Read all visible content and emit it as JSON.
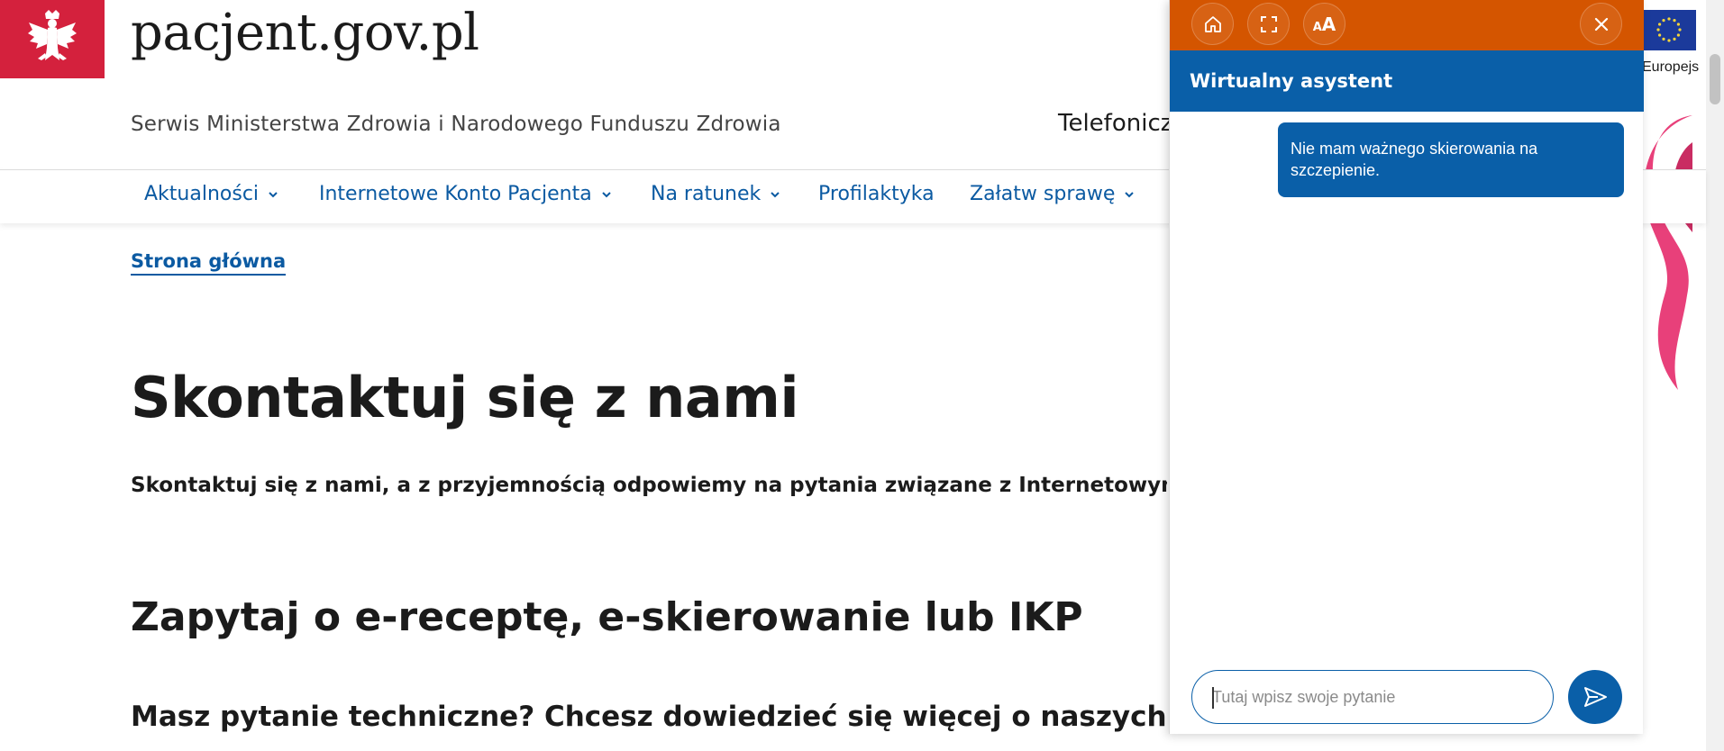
{
  "header": {
    "site_title": "pacjent.gov.pl",
    "subtitle": "Serwis Ministerstwa Zdrowia i Narodowego Funduszu Zdrowia",
    "phone_label": "Telefoniczn",
    "eu_label": "Europejs"
  },
  "nav": {
    "items": [
      {
        "label": "Aktualności",
        "has_dropdown": true
      },
      {
        "label": "Internetowe Konto Pacjenta",
        "has_dropdown": true
      },
      {
        "label": "Na ratunek",
        "has_dropdown": true
      },
      {
        "label": "Profilaktyka",
        "has_dropdown": false
      },
      {
        "label": "Załatw sprawę",
        "has_dropdown": true
      }
    ]
  },
  "main": {
    "breadcrumb": "Strona główna",
    "title": "Skontaktuj się z nami",
    "lead": "Skontaktuj się z nami, a z przyjemnością odpowiemy na pytania związane z Internetowym Kont",
    "h2": "Zapytaj o e-receptę, e-skierowanie lub IKP",
    "h3": "Masz pytanie techniczne? Chcesz dowiedzieć się więcej o naszych usług"
  },
  "chat": {
    "toolbar": {
      "font_size_label": "AA"
    },
    "title": "Wirtualny asystent",
    "messages": [
      {
        "from": "user",
        "text": "Nie mam ważnego skierowania na szczepienie."
      }
    ],
    "input": {
      "placeholder": "Tutaj wpisz swoje pytanie",
      "value": ""
    }
  },
  "colors": {
    "brand_red": "#d4213d",
    "link_blue": "#0b5aa2",
    "chat_orange": "#d45500",
    "chat_blue": "#0a5fa8"
  },
  "icons": {
    "emblem": "polish-eagle-icon",
    "home": "home-icon",
    "fullscreen": "fullscreen-icon",
    "font_size": "font-size-icon",
    "close": "close-icon",
    "send": "send-icon",
    "chevron": "chevron-down-icon"
  }
}
